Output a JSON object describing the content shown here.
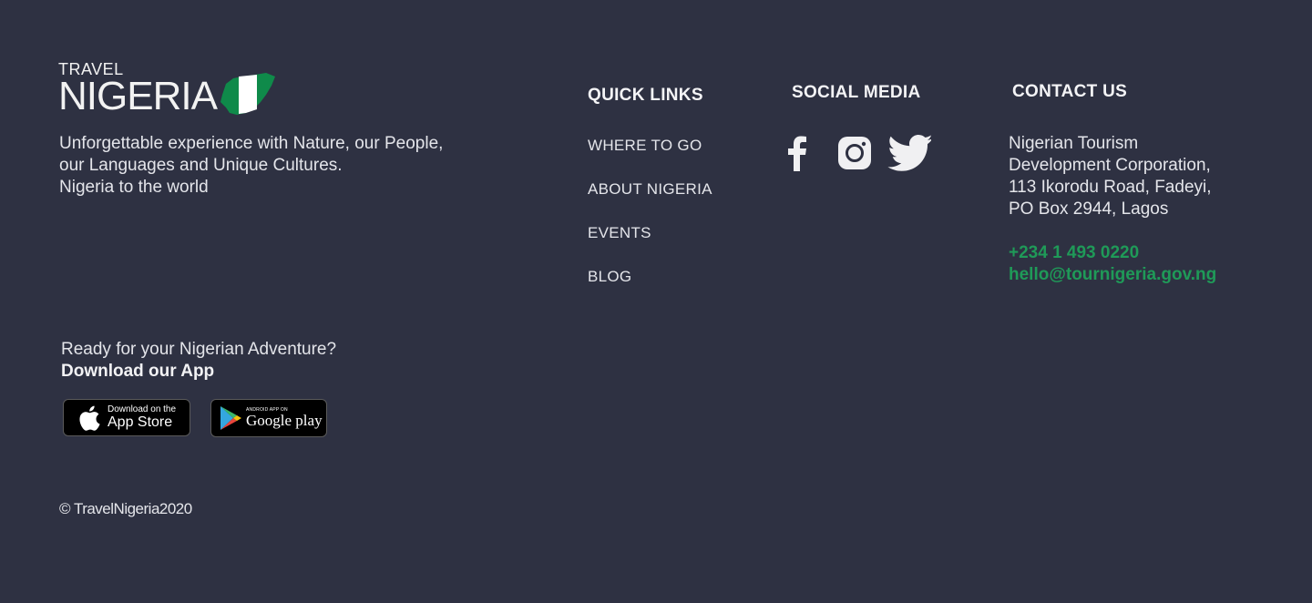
{
  "brand": {
    "logo_top": "TRAVEL",
    "logo_main": "NIGERIA",
    "flag_colors": {
      "green": "#0f8a4a",
      "white": "#ffffff"
    },
    "tagline_lines": [
      "Unforgettable experience with Nature, our People,",
      "our Languages and Unique Cultures.",
      "Nigeria to the world"
    ]
  },
  "quick_links": {
    "title": "QUICK LINKS",
    "items": [
      "WHERE TO GO",
      "ABOUT NIGERIA",
      "EVENTS",
      "BLOG"
    ]
  },
  "social_media": {
    "title": "SOCIAL MEDIA",
    "icons": [
      "facebook-icon",
      "instagram-icon",
      "twitter-icon"
    ]
  },
  "contact": {
    "title": "CONTACT US",
    "address_lines": [
      "Nigerian Tourism",
      "Development Corporation,",
      "113 Ikorodu Road, Fadeyi,",
      "PO Box 2944, Lagos"
    ],
    "phone": "+234 1 493 0220",
    "email": "hello@tournigeria.gov.ng",
    "accent_color": "#1f9a58"
  },
  "app": {
    "prompt": "Ready for your Nigerian Adventure?",
    "cta": "Download our App",
    "app_store": {
      "small": "Download on the",
      "big": "App Store"
    },
    "google_play": {
      "small": "ANDROID APP ON",
      "big": "Google play"
    }
  },
  "footer": {
    "copyright": "© TravelNigeria2020"
  },
  "colors": {
    "background": "#2e3142",
    "text": "#e4e5ea"
  }
}
